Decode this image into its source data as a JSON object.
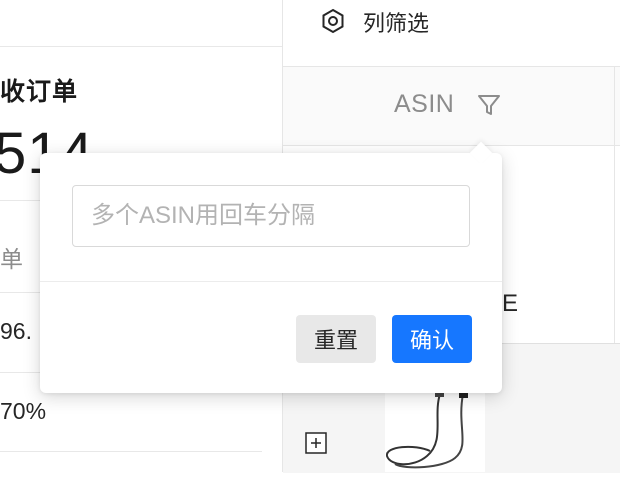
{
  "left_card": {
    "title": "收订单",
    "big_number": "514",
    "row_label": "单",
    "row_value1": "96.",
    "row_value2": "70%"
  },
  "toolbar": {
    "column_filter_label": "列筛选",
    "column_filter_icon": "settings-icon"
  },
  "table": {
    "header_asin": "ASIN",
    "header_filter_icon": "filter-icon",
    "cell_text": "E",
    "expand_icon": "plus-square-icon"
  },
  "popover": {
    "input_placeholder": "多个ASIN用回车分隔",
    "input_value": "",
    "reset_label": "重置",
    "confirm_label": "确认"
  },
  "colors": {
    "primary": "#1677ff",
    "reset_bg": "#e8e8e8"
  }
}
